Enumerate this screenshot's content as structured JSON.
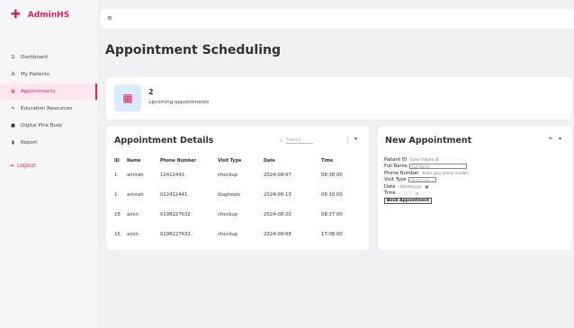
{
  "brand": {
    "name": "AdminHS"
  },
  "sidebar": {
    "items": [
      {
        "label": "Dashboard",
        "icon": "dashboard-icon",
        "glyph": "☰",
        "active": false
      },
      {
        "label": "My Patients",
        "icon": "patients-icon",
        "glyph": "👥",
        "active": false
      },
      {
        "label": "Appointments",
        "icon": "calendar-icon",
        "glyph": "▦",
        "active": true
      },
      {
        "label": "Education Resources",
        "icon": "education-icon",
        "glyph": "✎",
        "active": false
      },
      {
        "label": "Digital Pink Book",
        "icon": "book-icon",
        "glyph": "■",
        "active": false
      },
      {
        "label": "Report",
        "icon": "report-icon",
        "glyph": "▮",
        "active": false
      }
    ],
    "logout_label": "Logout"
  },
  "header": {
    "menu_glyph": "≡"
  },
  "page": {
    "title": "Appointment Scheduling"
  },
  "stats": {
    "count": "2",
    "label": "upcoming appointments"
  },
  "details": {
    "title": "Appointment Details",
    "search_placeholder": "Search...",
    "columns": [
      "ID",
      "Name",
      "Phone Number",
      "Visit Type",
      "Date",
      "Time"
    ],
    "rows": [
      [
        "1",
        "amirah",
        "12412441",
        "checkup",
        "2024-08-07",
        "08:38:00"
      ],
      [
        "1",
        "amirah",
        "012412441",
        "diagnosis",
        "2024-08-13",
        "08:30:00"
      ],
      [
        "15",
        "ainin",
        "0198227632",
        "checkup",
        "2024-08-20",
        "08:37:00"
      ],
      [
        "15",
        "ainin",
        "0198227632",
        "checkup",
        "2024-08-08",
        "17:08:00"
      ]
    ]
  },
  "new_appointment": {
    "title": "New Appointment",
    "patient_id_label": "Patient ID",
    "patient_id_placeholder": "Enter Patient ID",
    "full_name_label": "Full Name",
    "full_name_placeholder": "Full Name",
    "phone_label": "Phone Number",
    "phone_placeholder": "Enter your phone number",
    "visit_type_label": "Visit Type",
    "visit_type_value": "Select one ⌄",
    "date_label": "Date",
    "date_placeholder": "dd/mm/yyyy",
    "time_label": "Time",
    "time_placeholder": "-- : -- --",
    "book_button": "Book Appointment"
  },
  "colors": {
    "accent": "#e0215f",
    "stat_icon_bg": "#d8ebff"
  }
}
